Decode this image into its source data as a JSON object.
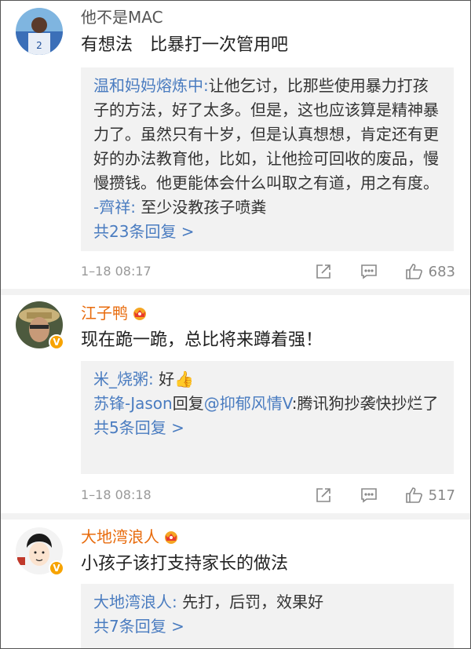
{
  "comments": [
    {
      "username": "他不是MAC",
      "text": "有想法　比暴打一次管用吧",
      "replies": [
        {
          "author": "温和妈妈熔炼中:",
          "body": "让他乞讨，比那些使用暴力打孩子的方法，好了太多。但是，这也应该算是精神暴力了。虽然只有十岁，但是认真想想，肯定还有更好的办法教育他，比如，让他捡可回收的废品，慢慢攒钱。他更能体会什么叫取之有道，用之有度。"
        },
        {
          "author": "-齊祥:",
          "body": "至少没教孩子喷粪"
        }
      ],
      "more": "共23条回复 >",
      "time": "1–18 08:17",
      "like_count": "683"
    },
    {
      "username": "江子鸭",
      "text": "现在跪一跪，总比将来蹲着强！",
      "replies": [
        {
          "author": "米_烧粥:",
          "body": "好👍"
        },
        {
          "author": "苏锋-Jason",
          "body_prefix": "回复",
          "mention": "@抑郁风情V",
          "body": ":腾讯狗抄袭快抄烂了"
        }
      ],
      "more": "共5条回复 >",
      "time": "1–18 08:18",
      "like_count": "517"
    },
    {
      "username": "大地湾浪人",
      "text": "小孩子该打支持家长的做法",
      "replies": [
        {
          "author": "大地湾浪人:",
          "body": "先打，后罚，效果好"
        }
      ],
      "more": "共7条回复 >"
    }
  ],
  "icons": {
    "share": "share-icon",
    "comment": "comment-icon",
    "like": "thumbs-up-icon",
    "crown": "vip-crown-icon",
    "verified": "verified-badge-icon"
  },
  "colors": {
    "link": "#4a7cc0",
    "vip_name": "#e86b0c",
    "reply_bg": "#f2f2f2"
  }
}
